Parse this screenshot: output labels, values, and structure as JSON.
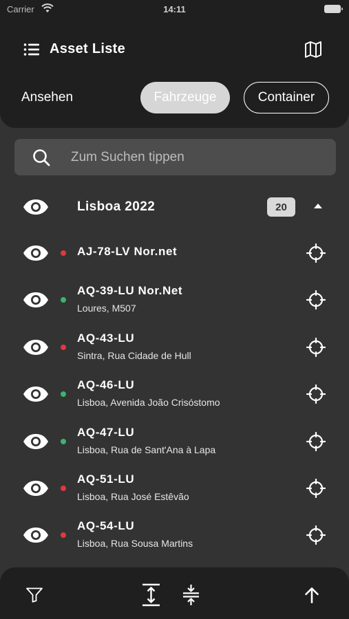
{
  "status_bar": {
    "carrier": "Carrier",
    "time": "14:11"
  },
  "header": {
    "title": "Asset Liste",
    "view_label": "Ansehen",
    "segments": [
      {
        "label": "Fahrzeuge",
        "selected": true
      },
      {
        "label": "Container",
        "selected": false
      }
    ]
  },
  "search": {
    "placeholder": "Zum Suchen tippen"
  },
  "group": {
    "title": "Lisboa 2022",
    "count": "20",
    "expanded": true
  },
  "status_colors": {
    "offline": "#e0393e",
    "online": "#3cb371"
  },
  "assets": [
    {
      "plate": "AJ-78-LV Nor.net",
      "address": "",
      "status": "offline"
    },
    {
      "plate": "AQ-39-LU Nor.Net",
      "address": "Loures, M507",
      "status": "online"
    },
    {
      "plate": "AQ-43-LU",
      "address": "Sintra, Rua Cidade de Hull",
      "status": "offline"
    },
    {
      "plate": "AQ-46-LU",
      "address": "Lisboa, Avenida João Crisóstomo",
      "status": "online"
    },
    {
      "plate": "AQ-47-LU",
      "address": "Lisboa, Rua de Sant'Ana à Lapa",
      "status": "online"
    },
    {
      "plate": "AQ-51-LU",
      "address": "Lisboa, Rua José Estêvão",
      "status": "offline"
    },
    {
      "plate": "AQ-54-LU",
      "address": "Lisboa, Rua Sousa Martins",
      "status": "offline"
    }
  ],
  "icons": {
    "header": [
      "list-menu-icon",
      "map-icon"
    ],
    "row": [
      "eye-icon",
      "locate-target-icon"
    ],
    "bottom_bar": [
      "filter-icon",
      "expand-all-icon",
      "collapse-all-icon",
      "scroll-to-top-icon"
    ]
  }
}
